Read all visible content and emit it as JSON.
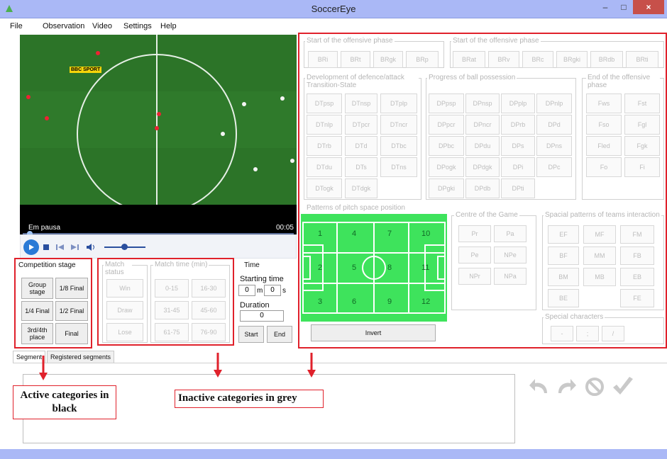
{
  "window": {
    "title": "SoccerEye",
    "minimize": "–",
    "maximize": "□",
    "close": "×"
  },
  "menu": [
    "File",
    "Observation",
    "Video",
    "Settings",
    "Help"
  ],
  "video": {
    "status": "Em pausa",
    "time": "00:05",
    "overlay_logo": "BBC SPORT",
    "progress_fraction": 0.03,
    "volume_fraction": 0.5
  },
  "left_panel": {
    "competition_stage": {
      "label": "Competition stage",
      "buttons": [
        "Group stage",
        "1/8 Final",
        "1/4 Final",
        "1/2 Final",
        "3rd/4th place",
        "Final"
      ]
    },
    "match_status": {
      "label": "Match status",
      "buttons": [
        "Win",
        "Draw",
        "Lose"
      ]
    },
    "match_time": {
      "label": "Match time (min)",
      "buttons": [
        "0-15",
        "16-30",
        "31-45",
        "45-60",
        "61-75",
        "76-90"
      ]
    },
    "time": {
      "label": "Time",
      "starting_label": "Starting time",
      "minutes": "0",
      "m_unit": "m",
      "seconds": "0",
      "s_unit": "s",
      "duration_label": "Duration",
      "duration": "0",
      "start": "Start",
      "end": "End"
    }
  },
  "right_panel": {
    "start_offensive_1": {
      "label": "Start of the offensive phase",
      "buttons": [
        "BRi",
        "BRt",
        "BRgk",
        "BRp"
      ]
    },
    "start_offensive_2": {
      "label": "Start of the offensive phase",
      "buttons": [
        "BRat",
        "BRv",
        "BRc",
        "BRgki",
        "BRdb",
        "BRti"
      ]
    },
    "development": {
      "label": "Development of defence/attack Transition-State",
      "buttons": [
        "DTpsp",
        "DTnsp",
        "DTplp",
        "DTnlp",
        "DTpcr",
        "DTncr",
        "DTrb",
        "DTd",
        "DTbc",
        "DTdu",
        "DTs",
        "DTns",
        "DTogk",
        "DTdgk"
      ]
    },
    "progress": {
      "label": "Progress of ball possession",
      "buttons": [
        "DPpsp",
        "DPnsp",
        "DPplp",
        "DPnlp",
        "DPpcr",
        "DPncr",
        "DPrb",
        "DPd",
        "DPbc",
        "DPdu",
        "DPs",
        "DPns",
        "DPogk",
        "DPdgk",
        "DPi",
        "DPc",
        "DPgki",
        "DPdb",
        "DPti"
      ]
    },
    "end_offensive": {
      "label": "End of the offensive phase",
      "buttons": [
        "Fws",
        "Fst",
        "Fso",
        "Fgl",
        "Fled",
        "Fgk",
        "Fo",
        "Fi"
      ]
    },
    "pitch_space": {
      "label": "Patterns of pitch space position",
      "zones": [
        "1",
        "2",
        "3",
        "4",
        "5",
        "6",
        "7",
        "8",
        "9",
        "10",
        "11",
        "12"
      ],
      "invert": "Invert"
    },
    "centre": {
      "label": "Centre of the Game",
      "buttons": [
        "Pr",
        "Pa",
        "Pe",
        "NPe",
        "NPr",
        "NPa"
      ]
    },
    "spacial": {
      "label": "Spacial patterns of teams interaction",
      "buttons": [
        "EF",
        "MF",
        "FM",
        "BF",
        "MM",
        "FB",
        "BM",
        "MB",
        "EB",
        "BE",
        "FE"
      ]
    },
    "special_chars": {
      "label": "Special characters",
      "buttons": [
        "-",
        ";",
        "/"
      ]
    }
  },
  "tabs": [
    "Segment",
    "Registered segments"
  ],
  "annotations": {
    "active": "Active categories in black",
    "inactive": "Inactive categories in grey"
  },
  "actions": {
    "icons": [
      "undo-icon",
      "redo-icon",
      "cancel-icon",
      "confirm-icon"
    ]
  },
  "colors": {
    "titlebar": "#aab8f6",
    "highlight_red": "#e0212b",
    "field_green": "#3ee35c",
    "pitch_green": "#2f7a2b"
  }
}
